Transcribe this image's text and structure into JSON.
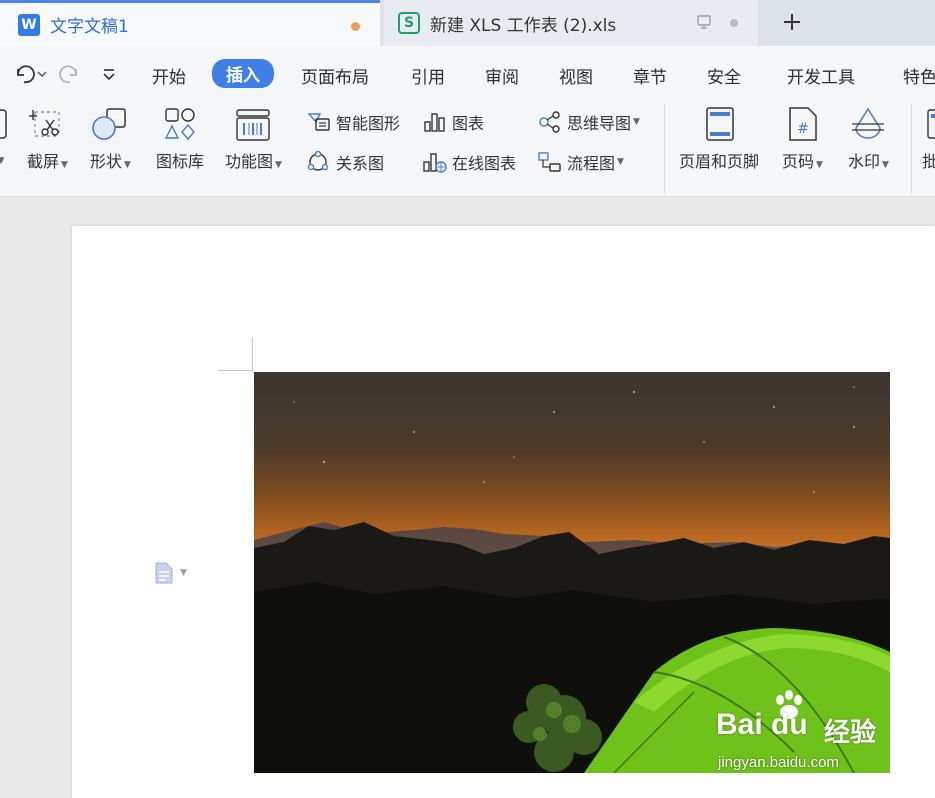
{
  "tabs": [
    {
      "title": "文字文稿1",
      "logo": "W",
      "unsaved": true,
      "active": true
    },
    {
      "title": "新建 XLS 工作表 (2).xls",
      "logo": "S",
      "active": false
    }
  ],
  "menu": {
    "items": [
      "开始",
      "插入",
      "页面布局",
      "引用",
      "审阅",
      "视图",
      "章节",
      "安全",
      "开发工具",
      "特色"
    ],
    "active": "插入"
  },
  "ribbon": {
    "screenshot": "截屏",
    "shape": "形状",
    "icon_library": "图标库",
    "function_chart": "功能图",
    "smart_art": "智能图形",
    "chart": "图表",
    "mind_map": "思维导图",
    "relation_chart": "关系图",
    "online_chart": "在线图表",
    "flow_chart": "流程图",
    "header_footer": "页眉和页脚",
    "page_number": "页码",
    "watermark": "水印",
    "cut_label": "批"
  },
  "watermark": {
    "brand": "Bai du",
    "cn": "经验",
    "site": "jingyan.baidu.com"
  },
  "colors": {
    "accent": "#3f7fe6",
    "tab_active_text": "#2f6fd6",
    "unsaved_dot": "#e8a05a",
    "tent_green": "#7dd21e"
  }
}
